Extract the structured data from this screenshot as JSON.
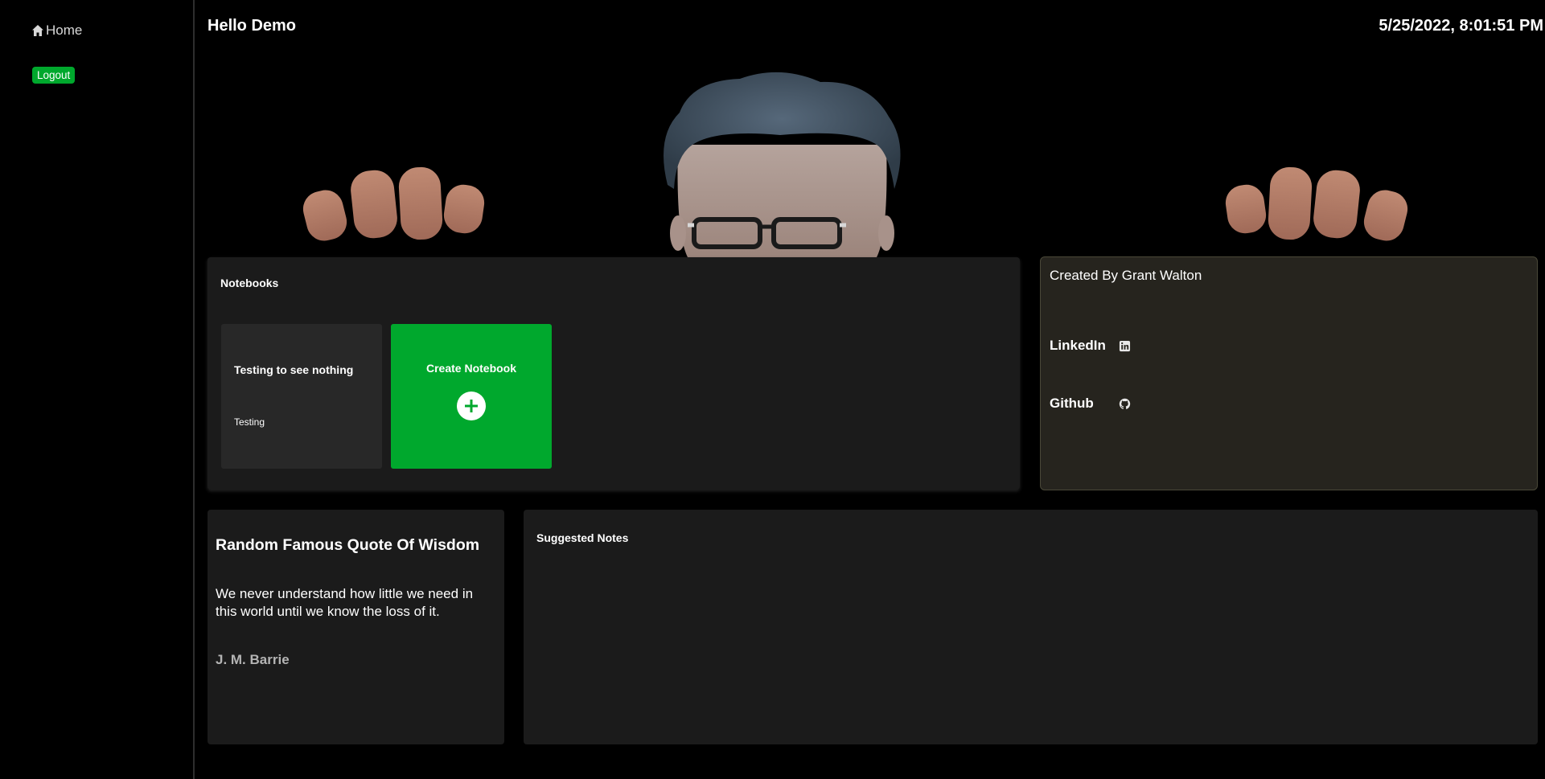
{
  "sidebar": {
    "home_label": "Home",
    "logout_label": "Logout"
  },
  "header": {
    "greeting": "Hello Demo",
    "datetime": "5/25/2022, 8:01:51 PM"
  },
  "notebooks": {
    "title": "Notebooks",
    "items": [
      {
        "title": "Testing to see nothing",
        "subtitle": "Testing"
      }
    ],
    "create_label": "Create Notebook"
  },
  "about": {
    "title": "Created By Grant Walton",
    "linkedin_label": "LinkedIn",
    "github_label": "Github"
  },
  "quote": {
    "title": "Random Famous Quote Of Wisdom",
    "text": "We never understand how little we need in this world until we know the loss of it.",
    "author": "J. M. Barrie"
  },
  "suggested": {
    "title": "Suggested Notes"
  },
  "icons": {
    "home": "home-icon",
    "plus": "plus-icon",
    "linkedin": "linkedin-icon",
    "github": "github-icon"
  },
  "colors": {
    "accent": "#00a82d",
    "card": "#1b1b1b",
    "about_card": "#26241e",
    "background": "#000000"
  }
}
